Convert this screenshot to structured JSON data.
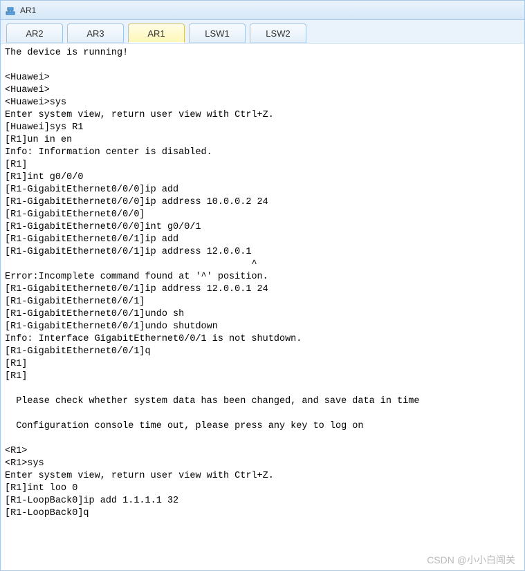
{
  "window": {
    "title": "AR1"
  },
  "tabs": [
    {
      "label": "AR2",
      "active": false
    },
    {
      "label": "AR3",
      "active": false
    },
    {
      "label": "AR1",
      "active": true
    },
    {
      "label": "LSW1",
      "active": false
    },
    {
      "label": "LSW2",
      "active": false
    }
  ],
  "console_lines": [
    "The device is running!",
    "",
    "<Huawei>",
    "<Huawei>",
    "<Huawei>sys",
    "Enter system view, return user view with Ctrl+Z.",
    "[Huawei]sys R1",
    "[R1]un in en",
    "Info: Information center is disabled.",
    "[R1]",
    "[R1]int g0/0/0",
    "[R1-GigabitEthernet0/0/0]ip add",
    "[R1-GigabitEthernet0/0/0]ip address 10.0.0.2 24",
    "[R1-GigabitEthernet0/0/0]",
    "[R1-GigabitEthernet0/0/0]int g0/0/1",
    "[R1-GigabitEthernet0/0/1]ip add",
    "[R1-GigabitEthernet0/0/1]ip address 12.0.0.1",
    "                                            ^",
    "Error:Incomplete command found at '^' position.",
    "[R1-GigabitEthernet0/0/1]ip address 12.0.0.1 24",
    "[R1-GigabitEthernet0/0/1]",
    "[R1-GigabitEthernet0/0/1]undo sh",
    "[R1-GigabitEthernet0/0/1]undo shutdown",
    "Info: Interface GigabitEthernet0/0/1 is not shutdown.",
    "[R1-GigabitEthernet0/0/1]q",
    "[R1]",
    "[R1]",
    "",
    "  Please check whether system data has been changed, and save data in time",
    "",
    "  Configuration console time out, please press any key to log on",
    "",
    "<R1>",
    "<R1>sys",
    "Enter system view, return user view with Ctrl+Z.",
    "[R1]int loo 0",
    "[R1-LoopBack0]ip add 1.1.1.1 32",
    "[R1-LoopBack0]q"
  ],
  "watermark": "CSDN @小小白闯关"
}
